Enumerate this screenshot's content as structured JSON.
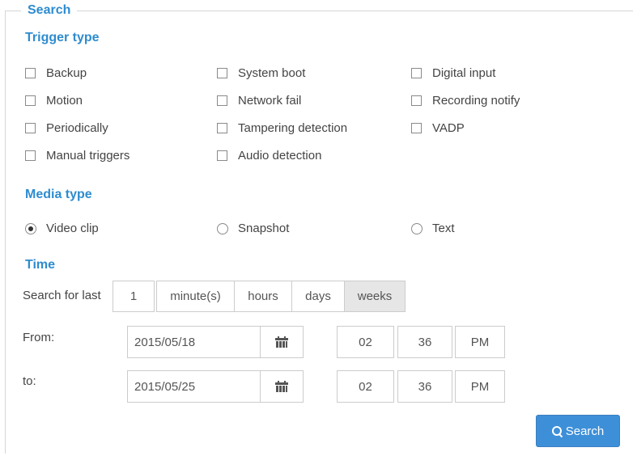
{
  "legend": "Search",
  "trigger_type": {
    "title": "Trigger type",
    "options": [
      "Backup",
      "System boot",
      "Digital input",
      "Motion",
      "Network fail",
      "Recording notify",
      "Periodically",
      "Tampering detection",
      "VADP",
      "Manual triggers",
      "Audio detection"
    ],
    "checked": []
  },
  "media_type": {
    "title": "Media type",
    "options": [
      "Video clip",
      "Snapshot",
      "Text"
    ],
    "selected": "Video clip"
  },
  "time": {
    "title": "Time",
    "search_for_last_label": "Search for last",
    "search_value": "1",
    "units": [
      "minute(s)",
      "hours",
      "days",
      "weeks"
    ],
    "selected_unit": "weeks",
    "from_label": "From:",
    "from_date": "2015/05/18",
    "from_hour": "02",
    "from_minute": "36",
    "from_ampm": "PM",
    "to_label": "to:",
    "to_date": "2015/05/25",
    "to_hour": "02",
    "to_minute": "36",
    "to_ampm": "PM"
  },
  "search_button": "Search",
  "icons": {
    "calendar": "calendar-icon",
    "search": "magnifier-icon"
  },
  "colors": {
    "accent": "#2e8ccf",
    "button": "#3d8fd8"
  }
}
